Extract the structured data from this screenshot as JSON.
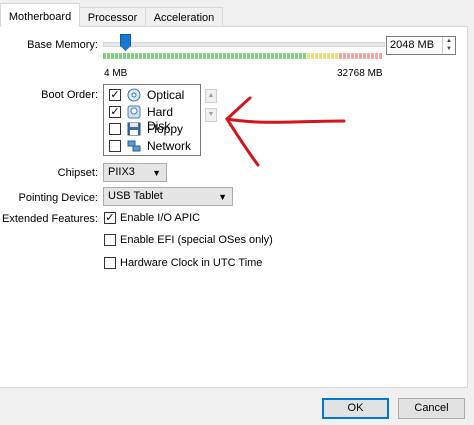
{
  "tabs": [
    {
      "label": "Motherboard"
    },
    {
      "label": "Processor"
    },
    {
      "label": "Acceleration"
    }
  ],
  "base_memory": {
    "label": "Base Memory:",
    "value": "2048 MB",
    "min_label": "4 MB",
    "max_label": "32768 MB",
    "slider_fraction": 0.0624,
    "colors": {
      "green": "#7ed27e",
      "yellow": "#e8e07a",
      "red": "#f4a3a3",
      "accent": "#1a78d2"
    }
  },
  "boot_order": {
    "label": "Boot Order:",
    "items": [
      {
        "label": "Optical",
        "checked": true,
        "icon": "optical-disc-icon"
      },
      {
        "label": "Hard Disk",
        "checked": true,
        "icon": "hard-disk-icon"
      },
      {
        "label": "Floppy",
        "checked": false,
        "icon": "floppy-icon"
      },
      {
        "label": "Network",
        "checked": false,
        "icon": "network-icon"
      }
    ]
  },
  "chipset": {
    "label": "Chipset:",
    "value": "PIIX3"
  },
  "pointing_device": {
    "label": "Pointing Device:",
    "value": "USB Tablet"
  },
  "extended_features": {
    "label": "Extended Features:",
    "options": [
      {
        "label": "Enable I/O APIC",
        "checked": true
      },
      {
        "label": "Enable EFI (special OSes only)",
        "checked": false
      },
      {
        "label": "Hardware Clock in UTC Time",
        "checked": false
      }
    ]
  },
  "buttons": {
    "ok": "OK",
    "cancel": "Cancel"
  },
  "annotation_color": "#d4151b"
}
